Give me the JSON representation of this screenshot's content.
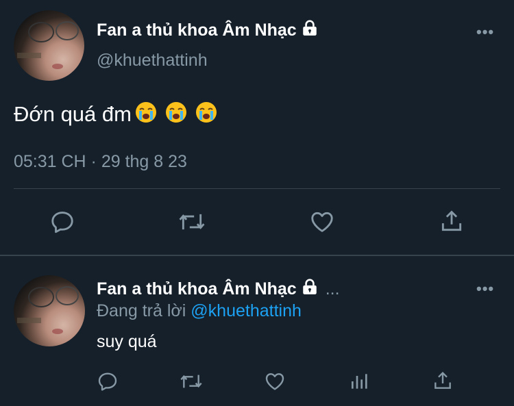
{
  "tweet": {
    "display_name": "Fan a thủ khoa Âm Nhạc",
    "handle": "@khuethattinh",
    "text": "Đớn quá đm",
    "emoji_count": 3,
    "timestamp": "05:31 CH · 29 thg 8 23",
    "icons": [
      "reply-icon",
      "retweet-icon",
      "like-icon",
      "share-icon"
    ]
  },
  "reply": {
    "display_name": "Fan a thủ khoa Âm Nhạc",
    "ellipsis": "...",
    "replying_prefix": "Đang trả lời",
    "replying_to": "@khuethattinh",
    "text": "suy quá",
    "icons": [
      "reply-icon",
      "retweet-icon",
      "like-icon",
      "analytics-icon",
      "share-icon"
    ]
  },
  "colors": {
    "background": "#15202b",
    "secondary_text": "#8899a6",
    "link": "#1da1f2",
    "divider": "#38444d"
  }
}
